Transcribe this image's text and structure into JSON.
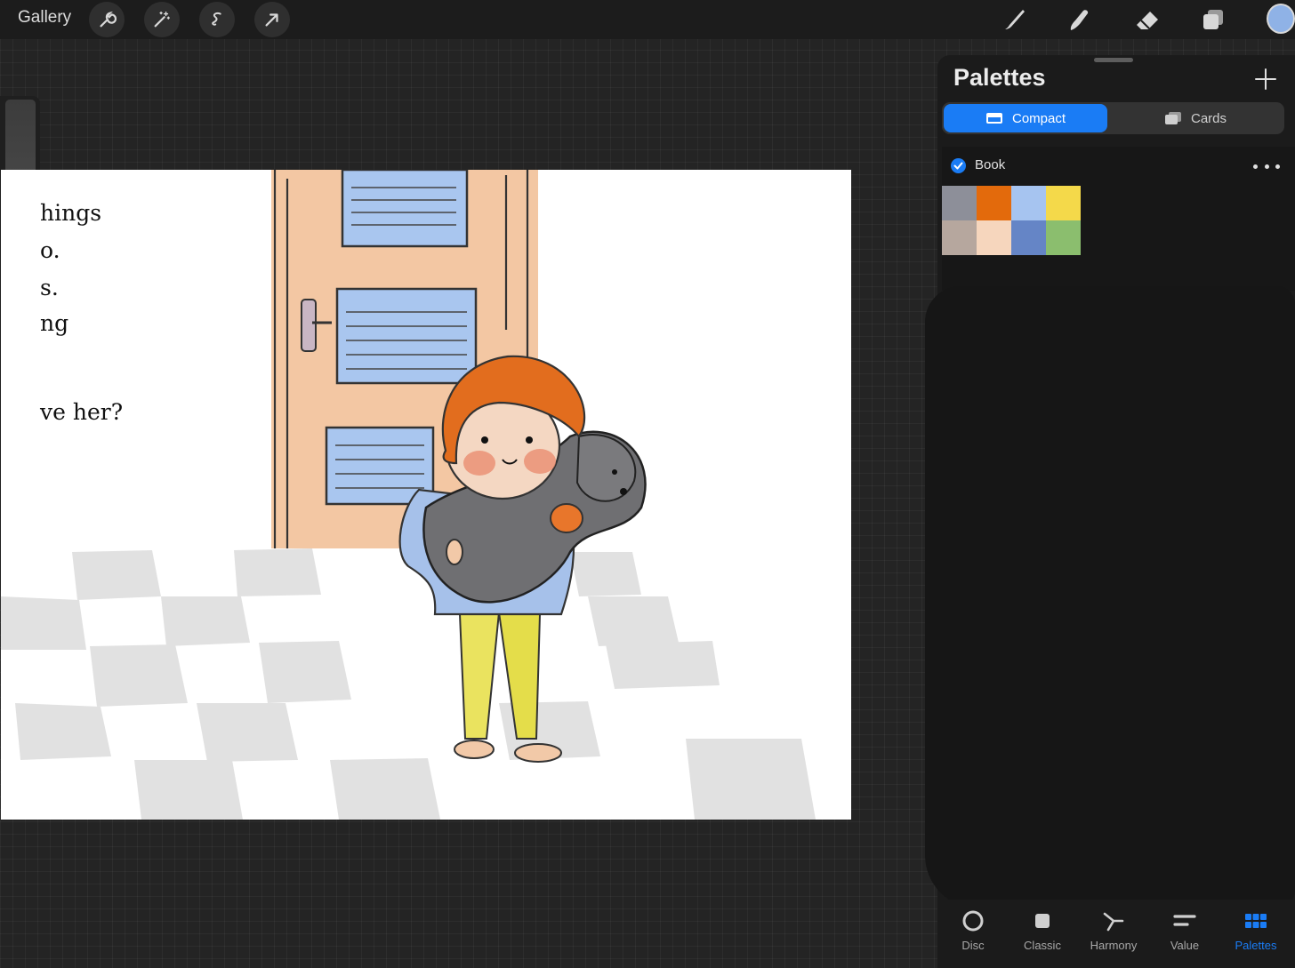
{
  "topbar": {
    "gallery_label": "Gallery",
    "left_tools": [
      "wrench-icon",
      "magic-wand-icon",
      "selection-icon",
      "transform-arrow-icon"
    ],
    "right_tools": [
      "brush-icon",
      "smudge-icon",
      "eraser-icon",
      "layers-icon"
    ],
    "current_color": "#8fb2e6"
  },
  "canvas": {
    "text_lines": [
      "hings",
      "o.",
      "s.",
      "ng",
      "ve her?"
    ]
  },
  "palettes": {
    "title": "Palettes",
    "views": [
      {
        "label": "Compact",
        "active": true
      },
      {
        "label": "Cards",
        "active": false
      }
    ],
    "palette": {
      "name": "Book",
      "default": true,
      "swatches": [
        "#8d8f99",
        "#e36a0c",
        "#a6c4f0",
        "#f4d94a",
        "#b6a79e",
        "#f6d6bd",
        "#6585c6",
        "#8bbe6e"
      ]
    }
  },
  "tabs": [
    {
      "label": "Disc",
      "icon": "disc-icon",
      "active": false
    },
    {
      "label": "Classic",
      "icon": "classic-icon",
      "active": false
    },
    {
      "label": "Harmony",
      "icon": "harmony-icon",
      "active": false
    },
    {
      "label": "Value",
      "icon": "value-icon",
      "active": false
    },
    {
      "label": "Palettes",
      "icon": "palettes-icon",
      "active": true
    }
  ],
  "colors": {
    "accent": "#1a7cf5",
    "panel_bg": "#1b1b1b",
    "canvas_bg": "#ffffff"
  }
}
